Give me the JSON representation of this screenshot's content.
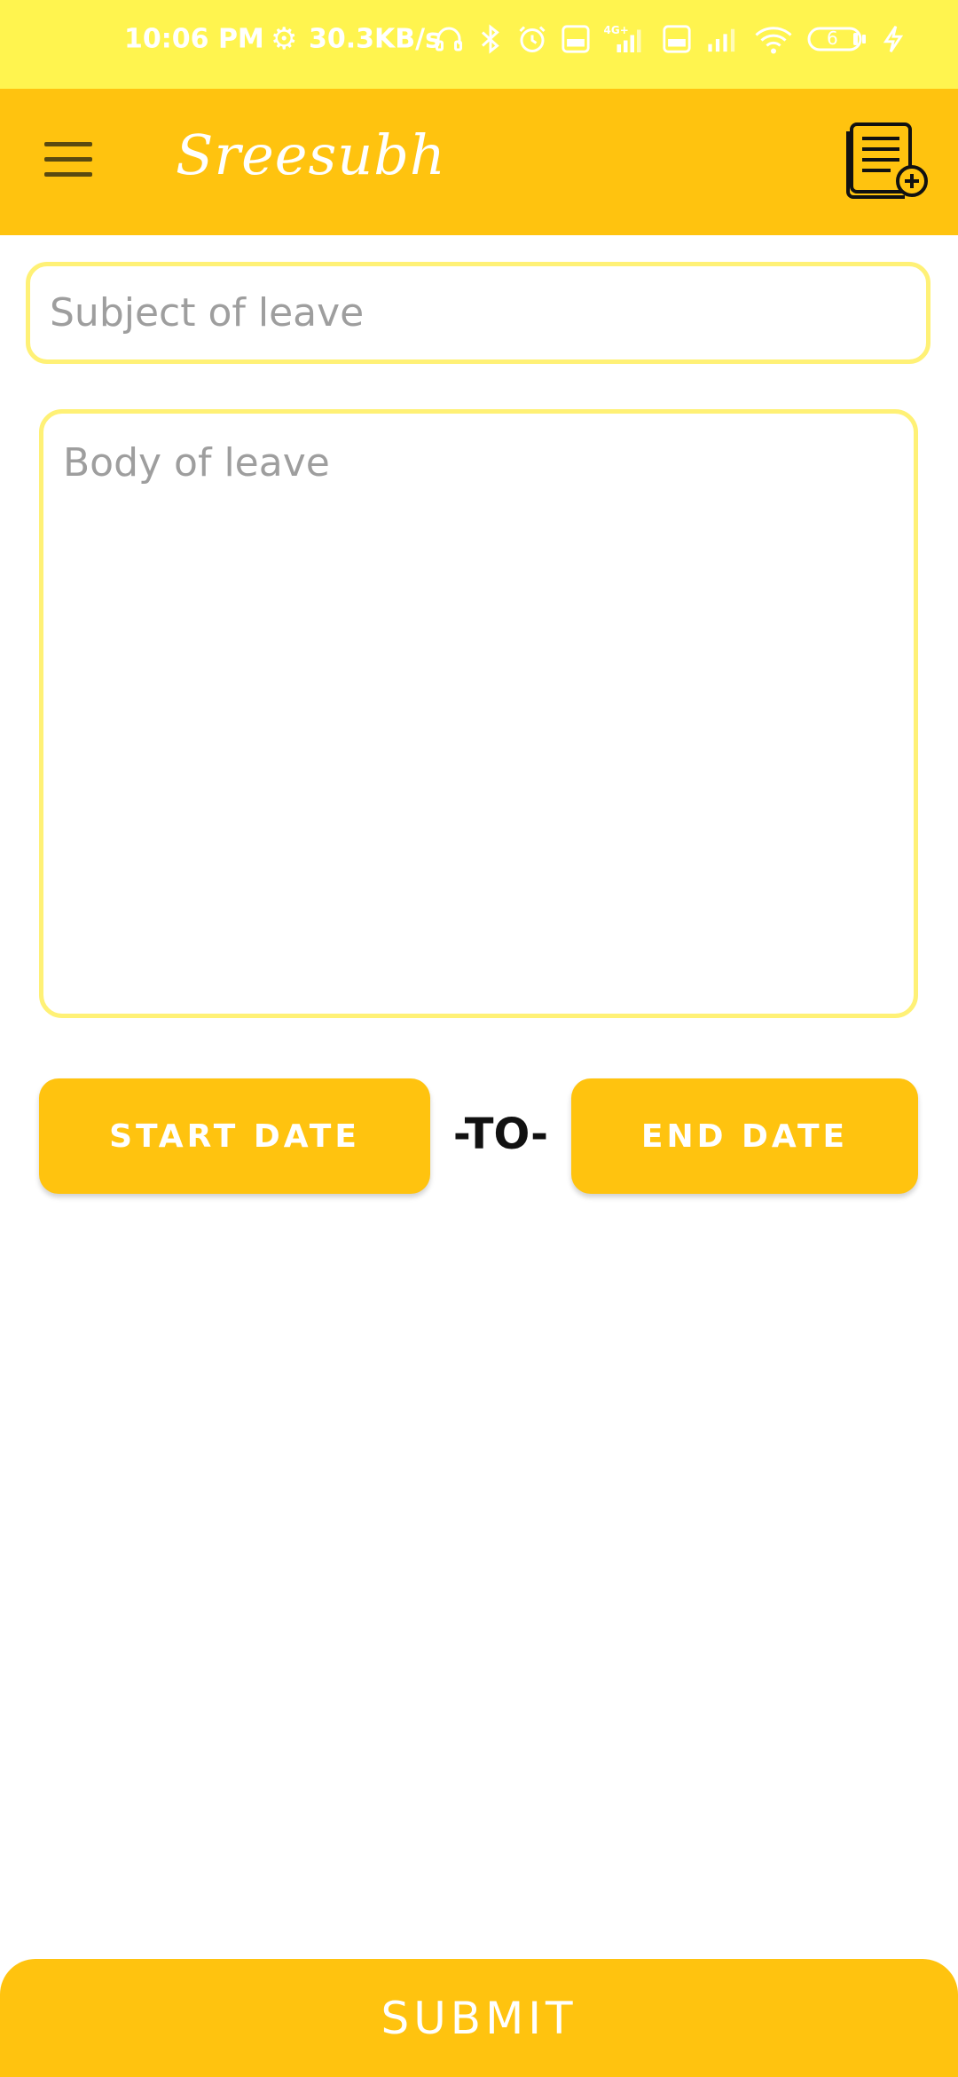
{
  "status_bar": {
    "time": "10:06 PM",
    "net_speed": "30.3KB/s",
    "battery_level": "6",
    "icons": [
      "gear-icon",
      "headphones-icon",
      "bluetooth-icon",
      "alarm-icon",
      "volte-icon",
      "signal-4g-icon",
      "volte-icon",
      "signal-icon",
      "wifi-icon",
      "battery-icon",
      "charging-icon"
    ],
    "background": "#FFF44F"
  },
  "app_bar": {
    "title": "Sreesubh",
    "background": "#FFC30F",
    "menu_icon": "hamburger-menu-icon",
    "action_icon": "document-add-icon"
  },
  "form": {
    "subject_placeholder": "Subject of leave",
    "subject_value": "",
    "body_placeholder": "Body of leave",
    "body_value": "",
    "border_color": "#FFF176"
  },
  "dates": {
    "start_label": "START DATE",
    "separator": "-TO-",
    "end_label": "END DATE"
  },
  "footer": {
    "submit_label": "SUBMIT"
  }
}
